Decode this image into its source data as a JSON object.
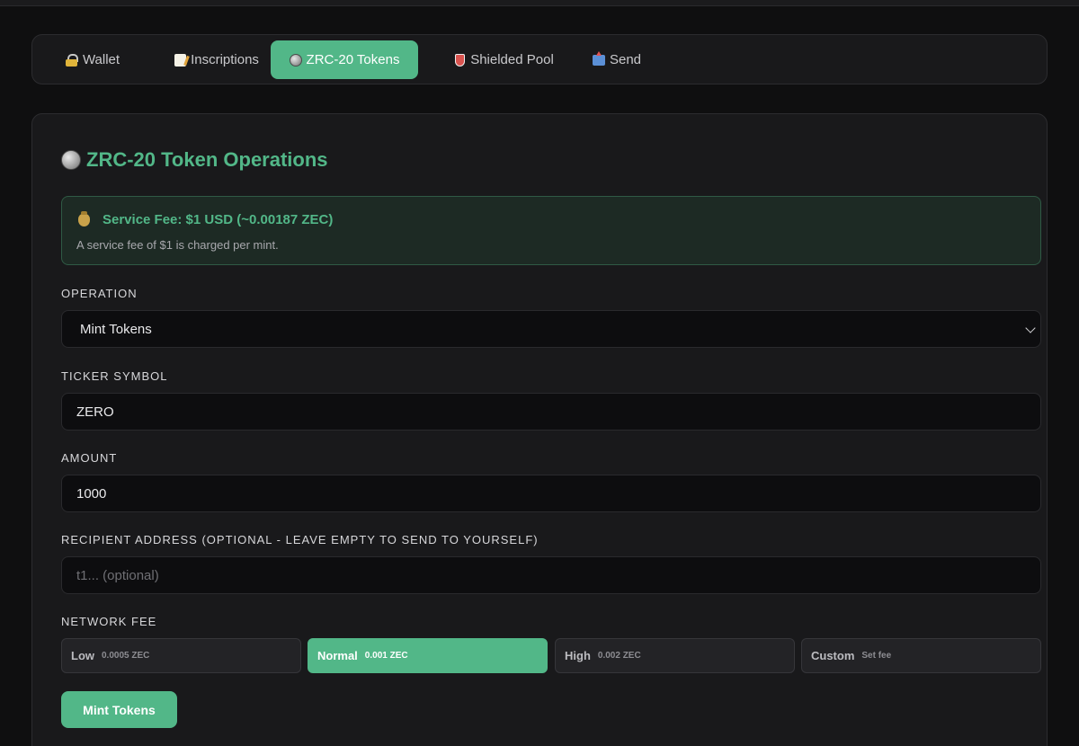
{
  "tabs": [
    {
      "label": "Wallet",
      "icon": "lock-icon"
    },
    {
      "label": "Inscriptions",
      "icon": "memo-icon"
    },
    {
      "label": "ZRC-20 Tokens",
      "icon": "coin-icon",
      "active": true
    },
    {
      "label": "Shielded Pool",
      "icon": "shield-icon"
    },
    {
      "label": "Send",
      "icon": "outbox-icon"
    }
  ],
  "panel": {
    "title": "ZRC-20 Token Operations",
    "fee_notice": {
      "heading": "Service Fee: $1 USD (~0.00187 ZEC)",
      "description": "A service fee of $1 is charged per mint."
    },
    "operation": {
      "label": "OPERATION",
      "value": "Mint Tokens"
    },
    "ticker": {
      "label": "TICKER SYMBOL",
      "value": "ZERO"
    },
    "amount": {
      "label": "AMOUNT",
      "value": "1000"
    },
    "recipient": {
      "label": "RECIPIENT ADDRESS (OPTIONAL - LEAVE EMPTY TO SEND TO YOURSELF)",
      "placeholder": "t1... (optional)"
    },
    "network_fee": {
      "label": "NETWORK FEE",
      "options": [
        {
          "name": "Low",
          "amount": "0.0005 ZEC"
        },
        {
          "name": "Normal",
          "amount": "0.001 ZEC",
          "selected": true
        },
        {
          "name": "High",
          "amount": "0.002 ZEC"
        },
        {
          "name": "Custom",
          "amount": "Set fee"
        }
      ]
    },
    "submit_label": "Mint Tokens"
  },
  "colors": {
    "accent": "#52b788",
    "background": "#0f0f10",
    "panel": "#19191b"
  }
}
